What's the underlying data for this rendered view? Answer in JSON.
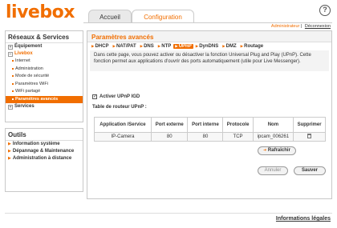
{
  "brand": {
    "logo": "livebox",
    "color": "#f16e00"
  },
  "header": {
    "help_icon": "?",
    "tabs": [
      {
        "label": "Accueil"
      },
      {
        "label": "Configuration"
      }
    ],
    "user": {
      "name": "Administrateur",
      "separator": "|",
      "logout": "Déconnexion"
    }
  },
  "sidebar": {
    "section1_title": "Réseaux & Services",
    "items": [
      {
        "label": "Équipement",
        "expanded": false
      },
      {
        "label": "Livebox",
        "expanded": true
      },
      {
        "label": "Services",
        "expanded": false
      }
    ],
    "livebox_sub": [
      {
        "label": "Internet"
      },
      {
        "label": "Administration"
      },
      {
        "label": "Mode de sécurité"
      },
      {
        "label": "Paramètres WiFi"
      },
      {
        "label": "WiFi partagé"
      },
      {
        "label": "Paramètres avancés",
        "active": true
      }
    ],
    "section2_title": "Outils",
    "tools": [
      {
        "label": "Information système"
      },
      {
        "label": "Dépannage & Maintenance"
      },
      {
        "label": "Administration à distance"
      }
    ]
  },
  "main": {
    "title": "Paramètres avancés",
    "subtabs": [
      {
        "label": "DHCP"
      },
      {
        "label": "NAT/PAT"
      },
      {
        "label": "DNS"
      },
      {
        "label": "NTP"
      },
      {
        "label": "UPnP",
        "active": true
      },
      {
        "label": "DynDNS"
      },
      {
        "label": "DMZ"
      },
      {
        "label": "Routage"
      }
    ],
    "description": "Dans cette page, vous pouvez activer ou désactiver la fonction Universal Plug and Play (UPnP). Cette fonction permet aux applications d'ouvrir des ports automatiquement (utile pour Live Messenger).",
    "checkbox_label": "Activer UPnP IGD",
    "checkbox_checked": true,
    "table_label": "Table de routeur UPnP :",
    "table": {
      "headers": [
        "Application /Service",
        "Port externe",
        "Port interne",
        "Protocole",
        "Nom",
        "Supprimer"
      ],
      "rows": [
        [
          "IP-Camera",
          "80",
          "80",
          "TCP",
          "ipcam_006261"
        ]
      ]
    },
    "refresh_label": "Rafraîchir",
    "cancel_label": "Annuler",
    "save_label": "Sauver"
  },
  "footer": {
    "legal": "Informations légales"
  }
}
